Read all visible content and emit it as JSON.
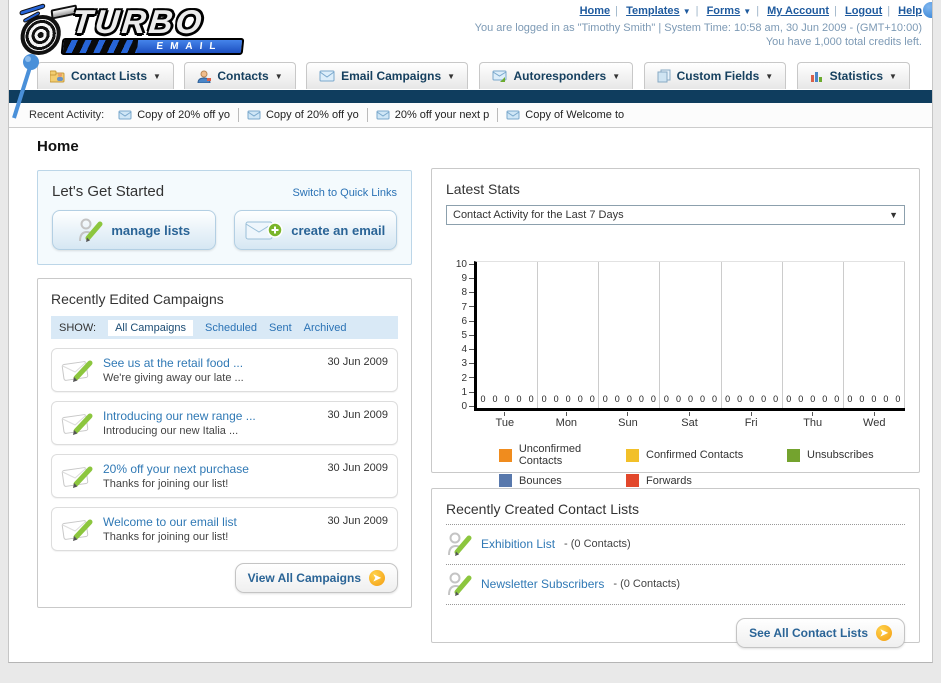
{
  "header": {
    "logo_title": "TURBO",
    "logo_subtitle": "EMAIL",
    "nav": {
      "home": "Home",
      "templates": "Templates",
      "forms": "Forms",
      "my_account": "My Account",
      "logout": "Logout",
      "help": "Help"
    },
    "login_info": "You are logged in as \"Timothy Smith\" | System Time: 10:58 am, 30 Jun 2009 - (GMT+10:00)",
    "credits_info": "You have 1,000 total credits left."
  },
  "tabs": [
    {
      "label": "Contact Lists"
    },
    {
      "label": "Contacts"
    },
    {
      "label": "Email Campaigns"
    },
    {
      "label": "Autoresponders"
    },
    {
      "label": "Custom Fields"
    },
    {
      "label": "Statistics"
    }
  ],
  "recent_activity": {
    "label": "Recent Activity:",
    "items": [
      "Copy of 20% off yo",
      "Copy of 20% off yo",
      "20% off your next p",
      "Copy of Welcome to"
    ]
  },
  "page_title": "Home",
  "get_started": {
    "title": "Let's Get Started",
    "switch_link": "Switch to Quick Links",
    "manage_lists_label": "manage lists",
    "create_email_label": "create an email"
  },
  "campaigns": {
    "title": "Recently Edited Campaigns",
    "show_label": "SHOW:",
    "filters": [
      "All Campaigns",
      "Scheduled",
      "Sent",
      "Archived"
    ],
    "items": [
      {
        "title": "See us at the retail food ...",
        "subtitle": "We're giving away our late ...",
        "date": "30 Jun 2009"
      },
      {
        "title": "Introducing our new range ...",
        "subtitle": "Introducing our new Italia ...",
        "date": "30 Jun 2009"
      },
      {
        "title": "20% off your next purchase",
        "subtitle": "Thanks for joining our list!",
        "date": "30 Jun 2009"
      },
      {
        "title": "Welcome to our email list",
        "subtitle": "Thanks for joining our list!",
        "date": "30 Jun 2009"
      }
    ],
    "view_all_label": "View All Campaigns"
  },
  "latest_stats": {
    "title": "Latest Stats",
    "dropdown_value": "Contact Activity for the Last 7 Days"
  },
  "chart_data": {
    "type": "bar",
    "title": "Contact Activity for the Last 7 Days",
    "categories": [
      "Tue",
      "Mon",
      "Sun",
      "Sat",
      "Fri",
      "Thu",
      "Wed"
    ],
    "series": [
      {
        "name": "Unconfirmed Contacts",
        "color": "#f08c1e",
        "values": [
          0,
          0,
          0,
          0,
          0,
          0,
          0
        ]
      },
      {
        "name": "Confirmed Contacts",
        "color": "#f2c029",
        "values": [
          0,
          0,
          0,
          0,
          0,
          0,
          0
        ]
      },
      {
        "name": "Unsubscribes",
        "color": "#74a32e",
        "values": [
          0,
          0,
          0,
          0,
          0,
          0,
          0
        ]
      },
      {
        "name": "Bounces",
        "color": "#5878ac",
        "values": [
          0,
          0,
          0,
          0,
          0,
          0,
          0
        ]
      },
      {
        "name": "Forwards",
        "color": "#e2472b",
        "values": [
          0,
          0,
          0,
          0,
          0,
          0,
          0
        ]
      }
    ],
    "xlabel": "",
    "ylabel": "",
    "ylim": [
      0,
      10
    ],
    "yticks": [
      0,
      1,
      2,
      3,
      4,
      5,
      6,
      7,
      8,
      9,
      10
    ],
    "grid": "vertical-day-separators",
    "legend_position": "bottom"
  },
  "contact_lists": {
    "title": "Recently Created Contact Lists",
    "items": [
      {
        "name": "Exhibition List",
        "detail": "- (0 Contacts)"
      },
      {
        "name": "Newsletter Subscribers",
        "detail": "- (0 Contacts)"
      }
    ],
    "see_all_label": "See All Contact Lists"
  }
}
